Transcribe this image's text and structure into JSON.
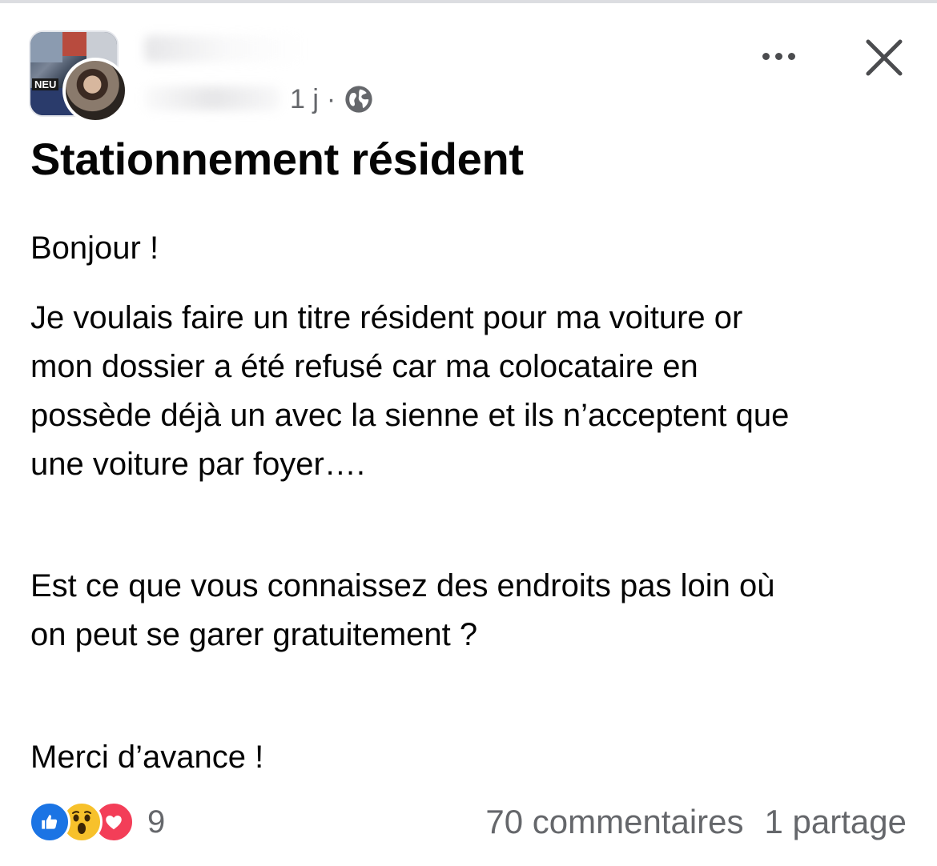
{
  "post": {
    "timestamp": "1 j",
    "separator": "·",
    "privacy_icon": "globe-icon",
    "title": "Stationnement résident",
    "body": {
      "greeting": "Bonjour !",
      "main": [
        "Je voulais faire un titre résident pour ma voiture or",
        "mon dossier a été refusé car ma colocataire en",
        "possède déjà un avec la sienne et ils n’acceptent que",
        "une voiture par foyer…."
      ],
      "question": [
        "Est ce que vous connaissez des endroits pas loin où",
        "on peut se garer gratuitement ?"
      ],
      "thanks": "Merci d’avance !"
    }
  },
  "header": {
    "more_icon": "more-options-icon",
    "close_icon": "close-icon"
  },
  "footer": {
    "reactions": [
      "like-icon",
      "wow-icon",
      "love-icon"
    ],
    "reaction_count": "9",
    "comments": "70 commentaires",
    "shares": "1 partage"
  },
  "colors": {
    "like": "#1b74e4",
    "wow": "#f7c12b",
    "love": "#f33e58",
    "secondary_text": "#65676b"
  }
}
